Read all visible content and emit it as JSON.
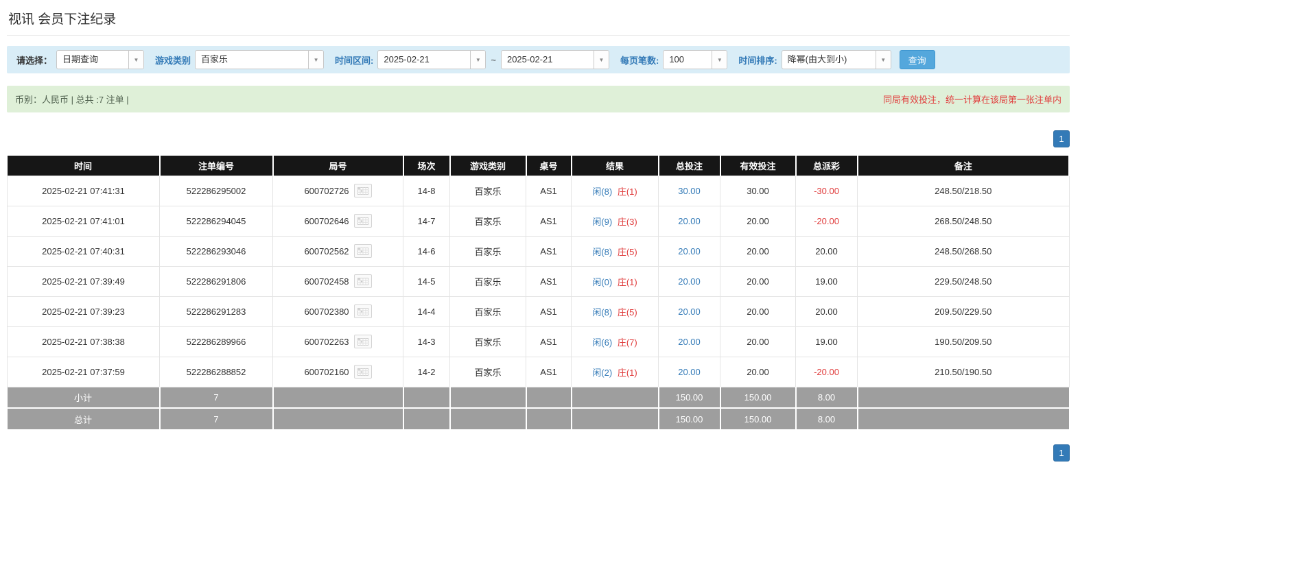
{
  "page": {
    "title": "视讯 会员下注纪录"
  },
  "filters": {
    "select_label": "请选择：",
    "select_value": "日期查询",
    "game_type_label": "游戏类别",
    "game_type_value": "百家乐",
    "time_range_label": "时间区间:",
    "date_from": "2025-02-21",
    "tilde": "~",
    "date_to": "2025-02-21",
    "page_size_label": "每页笔数:",
    "page_size_value": "100",
    "sort_label": "时间排序:",
    "sort_value": "降幂(由大到小)",
    "search_button": "查询"
  },
  "summary": {
    "left": "币别：人民币 | 总共 :7 注单 |",
    "right": "同局有效投注，统一计算在该局第一张注单内"
  },
  "pagination": {
    "page": "1"
  },
  "table": {
    "headers": [
      "时间",
      "注单编号",
      "局号",
      "场次",
      "游戏类别",
      "桌号",
      "结果",
      "总投注",
      "有效投注",
      "总派彩",
      "备注"
    ],
    "rows": [
      {
        "time": "2025-02-21 07:41:31",
        "bet_id": "522286295002",
        "round_id": "600702726",
        "session": "14-8",
        "game": "百家乐",
        "table_no": "AS1",
        "result_player": "闲(8)",
        "result_banker": "庄(1)",
        "total_bet": "30.00",
        "valid_bet": "30.00",
        "payout": "-30.00",
        "note": "248.50/218.50"
      },
      {
        "time": "2025-02-21 07:41:01",
        "bet_id": "522286294045",
        "round_id": "600702646",
        "session": "14-7",
        "game": "百家乐",
        "table_no": "AS1",
        "result_player": "闲(9)",
        "result_banker": "庄(3)",
        "total_bet": "20.00",
        "valid_bet": "20.00",
        "payout": "-20.00",
        "note": "268.50/248.50"
      },
      {
        "time": "2025-02-21 07:40:31",
        "bet_id": "522286293046",
        "round_id": "600702562",
        "session": "14-6",
        "game": "百家乐",
        "table_no": "AS1",
        "result_player": "闲(8)",
        "result_banker": "庄(5)",
        "total_bet": "20.00",
        "valid_bet": "20.00",
        "payout": "20.00",
        "note": "248.50/268.50"
      },
      {
        "time": "2025-02-21 07:39:49",
        "bet_id": "522286291806",
        "round_id": "600702458",
        "session": "14-5",
        "game": "百家乐",
        "table_no": "AS1",
        "result_player": "闲(0)",
        "result_banker": "庄(1)",
        "total_bet": "20.00",
        "valid_bet": "20.00",
        "payout": "19.00",
        "note": "229.50/248.50"
      },
      {
        "time": "2025-02-21 07:39:23",
        "bet_id": "522286291283",
        "round_id": "600702380",
        "session": "14-4",
        "game": "百家乐",
        "table_no": "AS1",
        "result_player": "闲(8)",
        "result_banker": "庄(5)",
        "total_bet": "20.00",
        "valid_bet": "20.00",
        "payout": "20.00",
        "note": "209.50/229.50"
      },
      {
        "time": "2025-02-21 07:38:38",
        "bet_id": "522286289966",
        "round_id": "600702263",
        "session": "14-3",
        "game": "百家乐",
        "table_no": "AS1",
        "result_player": "闲(6)",
        "result_banker": "庄(7)",
        "total_bet": "20.00",
        "valid_bet": "20.00",
        "payout": "19.00",
        "note": "190.50/209.50"
      },
      {
        "time": "2025-02-21 07:37:59",
        "bet_id": "522286288852",
        "round_id": "600702160",
        "session": "14-2",
        "game": "百家乐",
        "table_no": "AS1",
        "result_player": "闲(2)",
        "result_banker": "庄(1)",
        "total_bet": "20.00",
        "valid_bet": "20.00",
        "payout": "-20.00",
        "note": "210.50/190.50"
      }
    ],
    "subtotal": {
      "label": "小计",
      "count": "7",
      "total_bet": "150.00",
      "valid_bet": "150.00",
      "payout": "8.00"
    },
    "total": {
      "label": "总计",
      "count": "7",
      "total_bet": "150.00",
      "valid_bet": "150.00",
      "payout": "8.00"
    }
  },
  "icons": {
    "combo_arrow": "▼",
    "roadmap": "roadmap-grid"
  },
  "colors": {
    "accent_blue": "#337ab7",
    "red": "#e03c3c",
    "header_bg": "#161616",
    "footer_bg": "#9e9e9e",
    "filter_bg": "#d9edf7",
    "summary_bg": "#dff0d8",
    "query_btn": "#54a7dc"
  }
}
